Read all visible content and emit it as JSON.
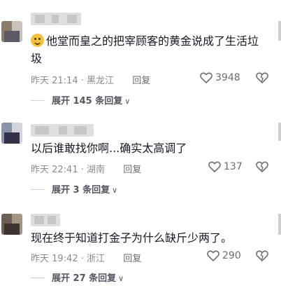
{
  "comments": [
    {
      "text_line1": "他堂而皇之的把宰顾客的黄金说成了生活垃",
      "text_line2": "圾",
      "time": "昨天 21:14",
      "location": "黑龙江",
      "reply_label": "回复",
      "likes": "3948",
      "expand_label": "展开 145 条回复",
      "has_emoji": true
    },
    {
      "text_line1": "以后谁敢找你啊...确实太高调了",
      "time": "昨天 22:41",
      "location": "湖南",
      "reply_label": "回复",
      "likes": "137",
      "expand_label": "展开 3 条回复"
    },
    {
      "text_line1": "现在终于知道打金子为什么缺斤少两了。",
      "time": "昨天 19:42",
      "location": "浙江",
      "reply_label": "回复",
      "likes": "290",
      "expand_label": "展开 27 条回复"
    }
  ],
  "separator": "·",
  "icons": {
    "like": "heart-outline-icon",
    "dislike": "broken-heart-icon",
    "expand": "chevron-down-icon",
    "emoji": "smiling-face-icon"
  },
  "colors": {
    "text": "#161823",
    "meta": "#8a8b91",
    "emoji": "#f4c242"
  }
}
